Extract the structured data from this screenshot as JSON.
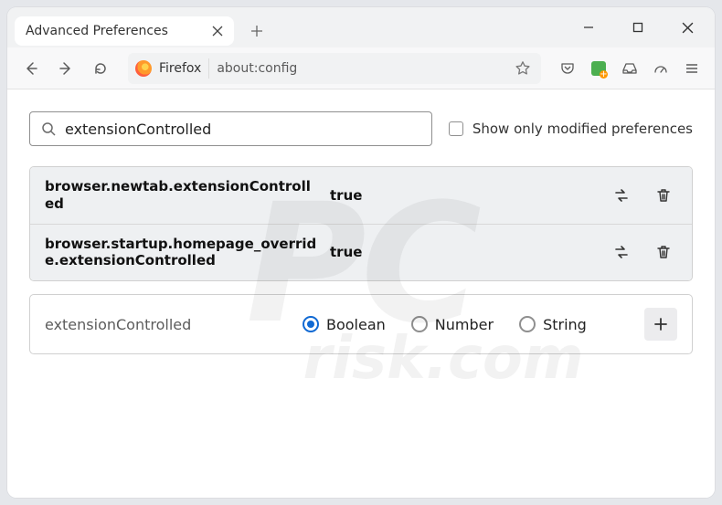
{
  "window": {
    "tab_title": "Advanced Preferences"
  },
  "toolbar": {
    "identity_label": "Firefox",
    "url": "about:config"
  },
  "config": {
    "search_value": "extensionControlled",
    "show_modified_label": "Show only modified preferences",
    "prefs": [
      {
        "name": "browser.newtab.extensionControlled",
        "value": "true"
      },
      {
        "name": "browser.startup.homepage_override.extensionControlled",
        "value": "true"
      }
    ],
    "add": {
      "name": "extensionControlled",
      "types": [
        "Boolean",
        "Number",
        "String"
      ],
      "selected": "Boolean"
    }
  },
  "watermark": {
    "main": "PC",
    "sub": "risk.com"
  }
}
